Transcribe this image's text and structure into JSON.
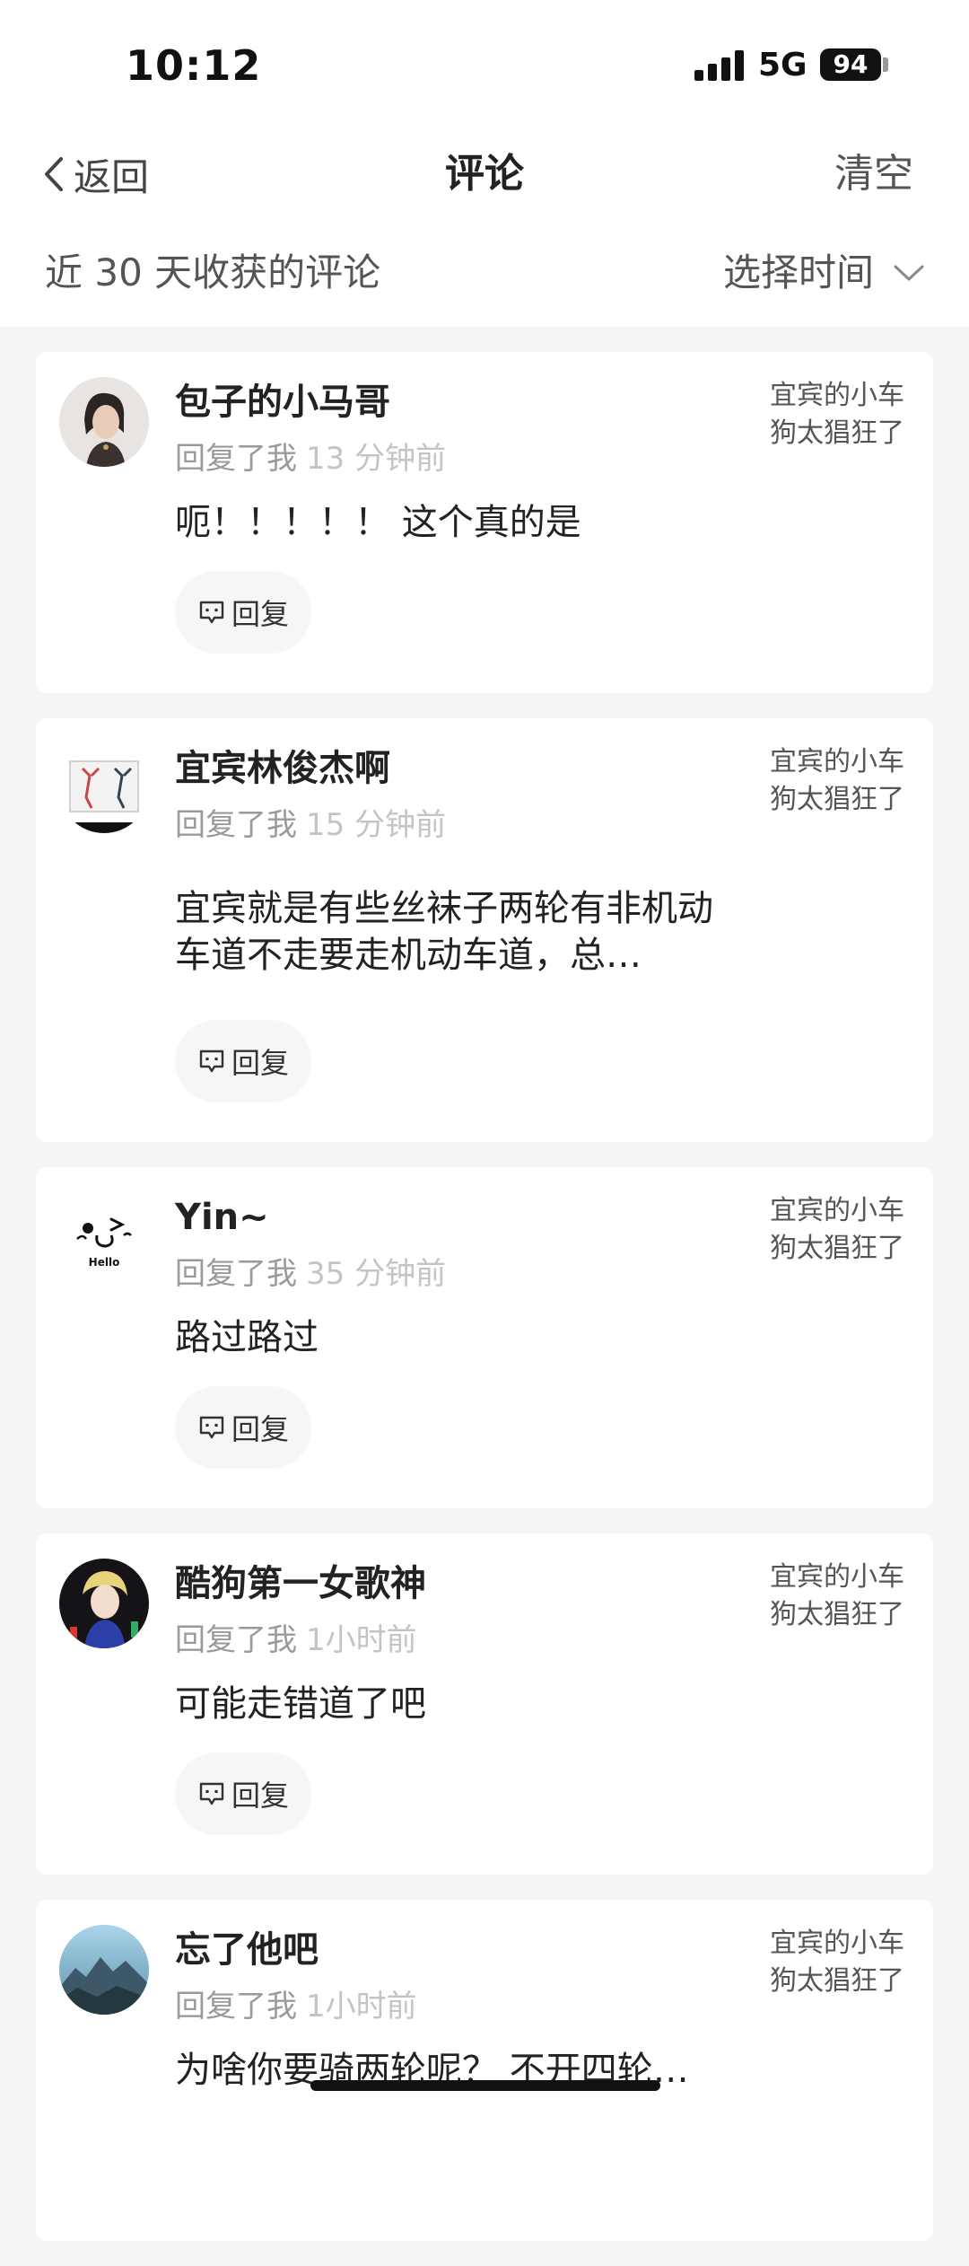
{
  "status_bar": {
    "time": "10:12",
    "network": "5G",
    "battery": "94"
  },
  "nav": {
    "back_label": "返回",
    "title": "评论",
    "clear_label": "清空"
  },
  "filter": {
    "title": "近 30 天收获的评论",
    "select_label": "选择时间"
  },
  "comments": [
    {
      "username": "包子的小马哥",
      "action": "回复了我",
      "time": "13 分钟前",
      "content": "呃！！！！！ 这个真的是",
      "reply_label": "回复",
      "ref_text": "宜宾的小车狗太猖狂了"
    },
    {
      "username": "宜宾林俊杰啊",
      "action": "回复了我",
      "time": "15 分钟前",
      "content": "宜宾就是有些丝袜子两轮有非机动车道不走要走机动车道，总…",
      "reply_label": "回复",
      "ref_text": "宜宾的小车狗太猖狂了"
    },
    {
      "username": "Yin~",
      "action": "回复了我",
      "time": "35 分钟前",
      "content": "路过路过",
      "reply_label": "回复",
      "ref_text": "宜宾的小车狗太猖狂了"
    },
    {
      "username": "酷狗第一女歌神",
      "action": "回复了我",
      "time": "1小时前",
      "content": "可能走错道了吧",
      "reply_label": "回复",
      "ref_text": "宜宾的小车狗太猖狂了"
    },
    {
      "username": "忘了他吧",
      "action": "回复了我",
      "time": "1小时前",
      "content": "为啥你要骑两轮呢？ 不开四轮…",
      "reply_label": "回复",
      "ref_text": "宜宾的小车狗太猖狂了"
    }
  ],
  "avatar_label_3": "Hello",
  "icons": {
    "back": "chevron-left-icon",
    "select": "chevron-down-icon",
    "reply": "comment-bubble-icon"
  }
}
